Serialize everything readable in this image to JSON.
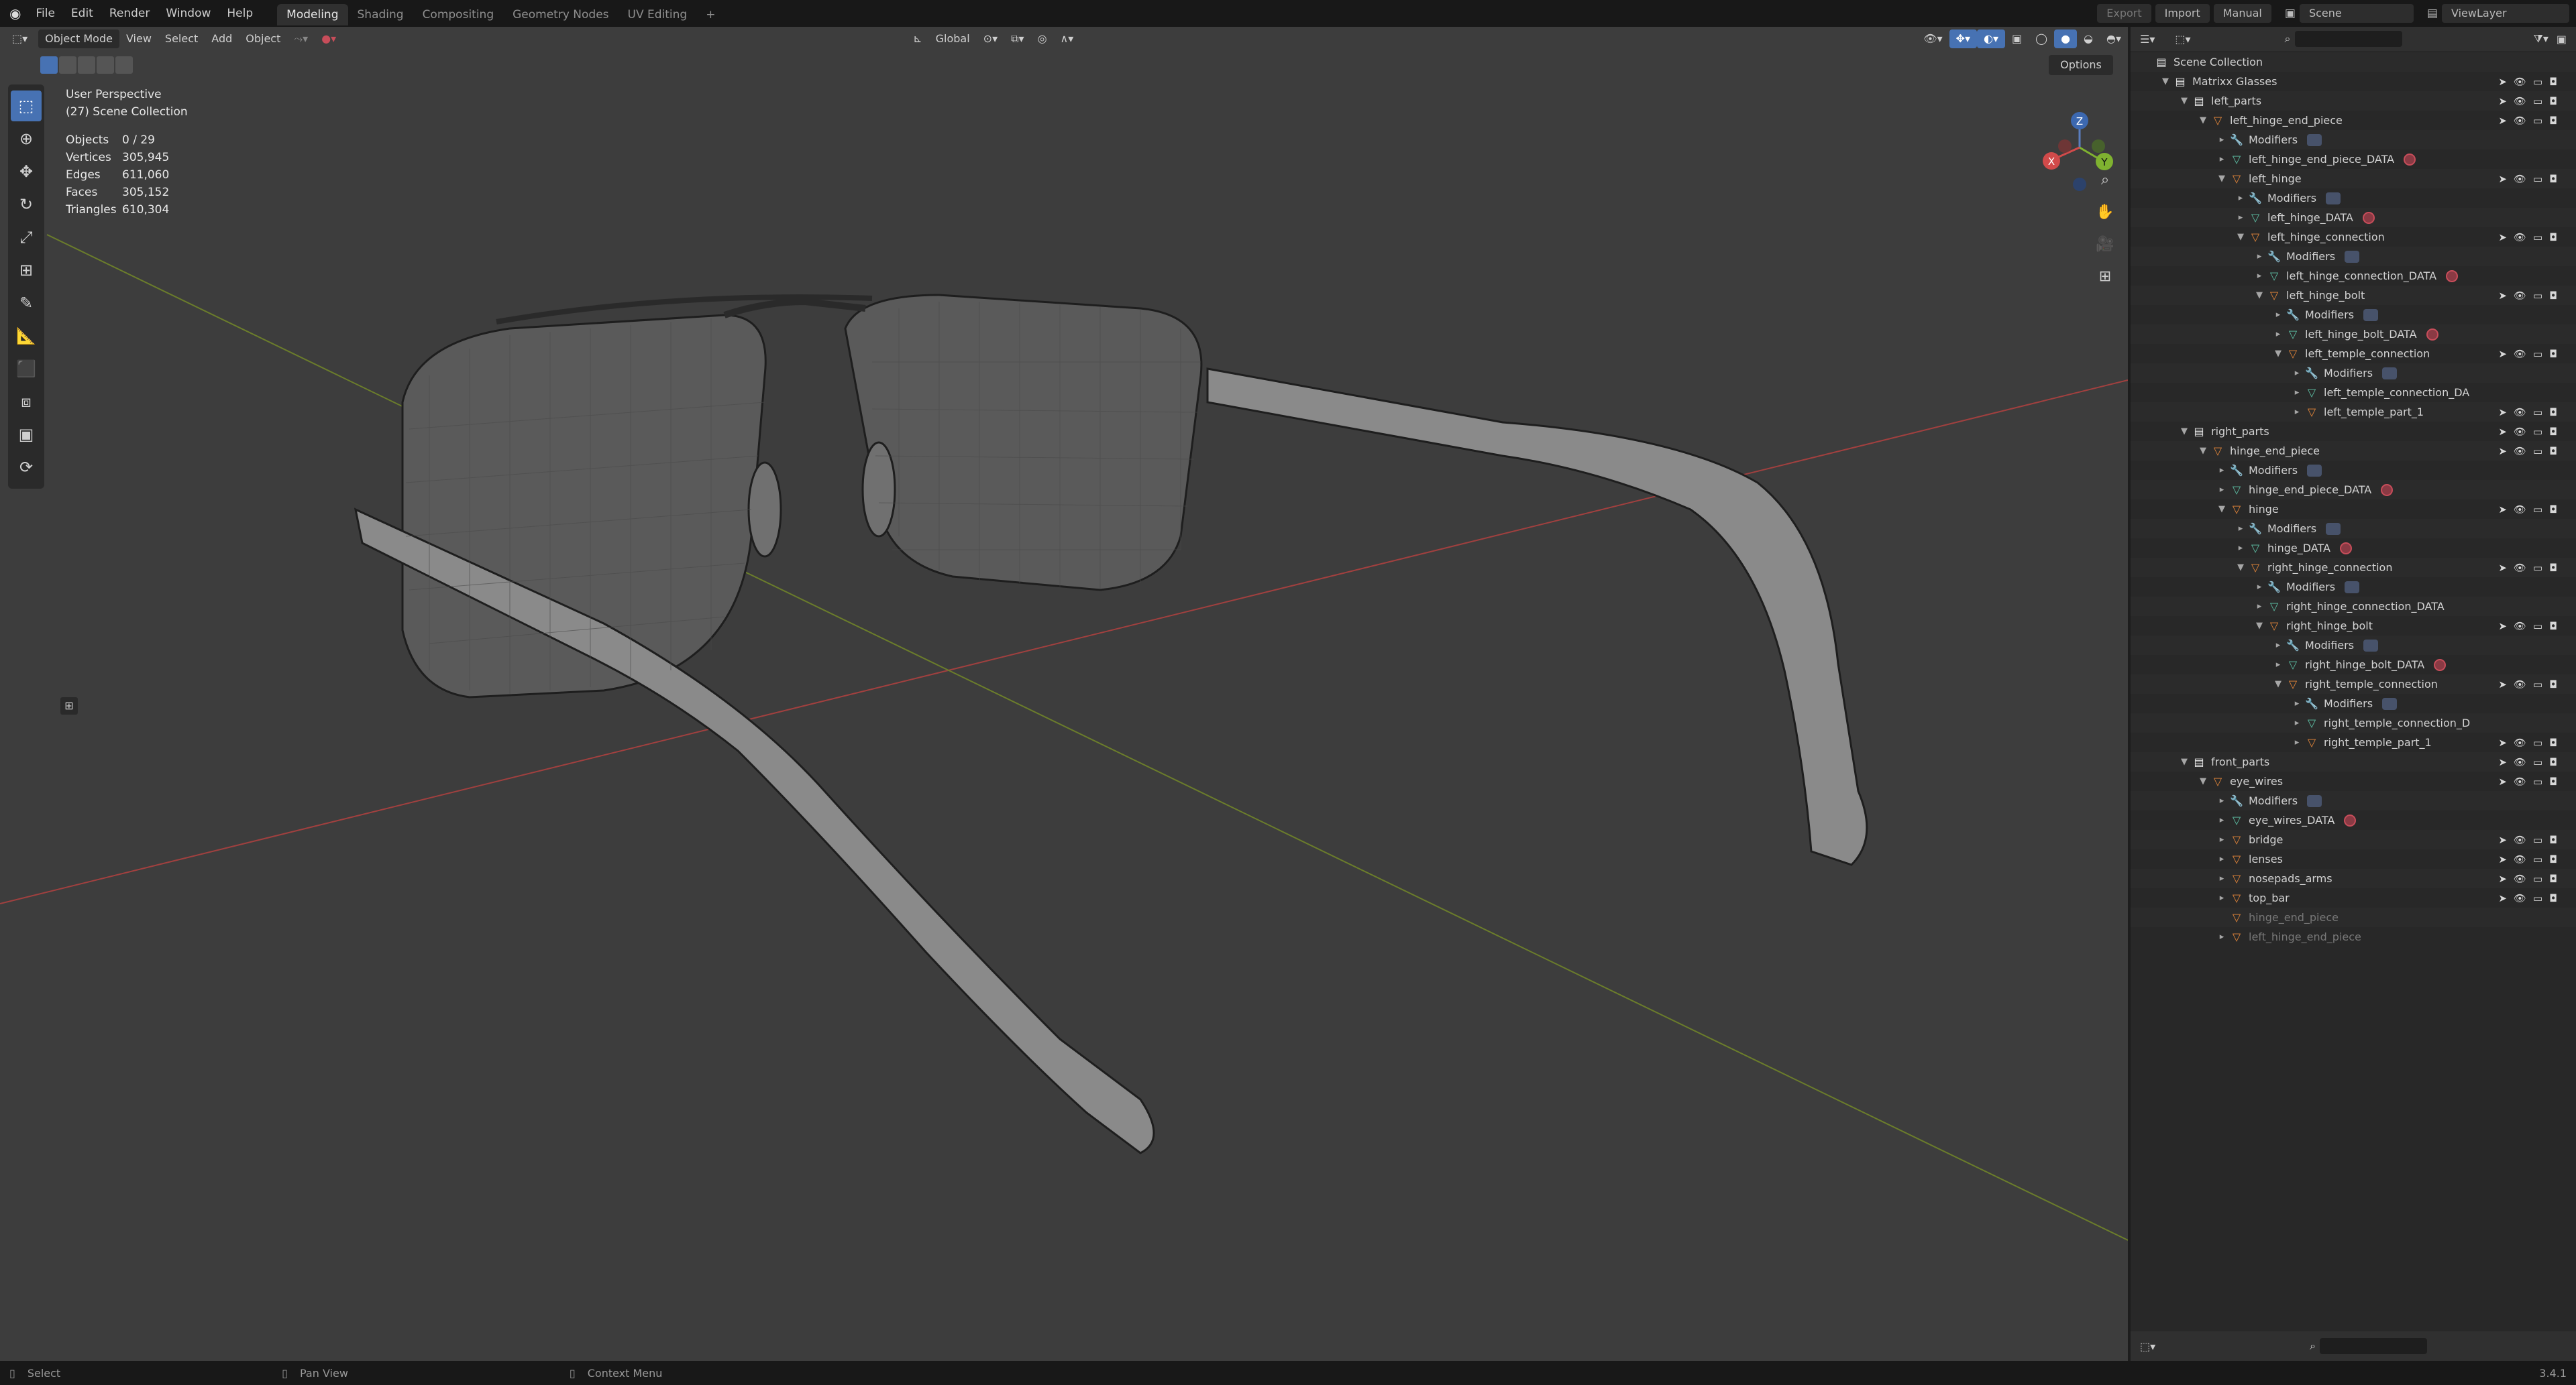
{
  "app": {
    "menus": [
      "File",
      "Edit",
      "Render",
      "Window",
      "Help"
    ],
    "workspace_tabs": [
      "Modeling",
      "Shading",
      "Compositing",
      "Geometry Nodes",
      "UV Editing"
    ],
    "active_workspace": "Modeling",
    "add_tab": "+",
    "top_buttons": {
      "export": "Export",
      "import": "Import",
      "manual": "Manual"
    },
    "scene_label": "Scene",
    "view_layer_label": "ViewLayer",
    "accent": "#4772b3"
  },
  "viewport": {
    "header": {
      "mode": "Object Mode",
      "menus": [
        "View",
        "Select",
        "Add",
        "Object"
      ],
      "transform_orientation": "Global",
      "options": "Options"
    },
    "overlay": {
      "view_name": "User Perspective",
      "collection": "(27) Scene Collection",
      "stats": [
        {
          "label": "Objects",
          "value": "0 / 29"
        },
        {
          "label": "Vertices",
          "value": "305,945"
        },
        {
          "label": "Edges",
          "value": "611,060"
        },
        {
          "label": "Faces",
          "value": "305,152"
        },
        {
          "label": "Triangles",
          "value": "610,304"
        }
      ]
    },
    "gizmo_axes": {
      "x": "X",
      "y": "Y",
      "z": "Z"
    },
    "tools": [
      "select-box-icon",
      "cursor-icon",
      "move-icon",
      "rotate-icon",
      "scale-icon",
      "transform-icon",
      "annotate-icon",
      "measure-icon",
      "add-cube-icon",
      "extrude-icon",
      "inset-icon",
      "spin-icon"
    ]
  },
  "outliner": {
    "search_placeholder": "",
    "rows": [
      {
        "depth": 0,
        "tri": "",
        "icon": "coll",
        "label": "Scene Collection",
        "badge": "",
        "vis": false,
        "dim": false
      },
      {
        "depth": 1,
        "tri": "▼",
        "icon": "coll",
        "label": "Matrixx Glasses",
        "badge": "",
        "vis": true,
        "dim": false
      },
      {
        "depth": 2,
        "tri": "▼",
        "icon": "coll",
        "label": "left_parts",
        "badge": "",
        "vis": true,
        "dim": false
      },
      {
        "depth": 3,
        "tri": "▼",
        "icon": "obj",
        "label": "left_hinge_end_piece",
        "badge": "",
        "vis": true,
        "dim": false
      },
      {
        "depth": 4,
        "tri": "▸",
        "icon": "mod",
        "label": "Modifiers",
        "badge": "mod",
        "vis": false,
        "dim": false
      },
      {
        "depth": 4,
        "tri": "▸",
        "icon": "mesh",
        "label": "left_hinge_end_piece_DATA",
        "badge": "data",
        "vis": false,
        "dim": false
      },
      {
        "depth": 4,
        "tri": "▼",
        "icon": "obj",
        "label": "left_hinge",
        "badge": "",
        "vis": true,
        "dim": false
      },
      {
        "depth": 5,
        "tri": "▸",
        "icon": "mod",
        "label": "Modifiers",
        "badge": "mod",
        "vis": false,
        "dim": false
      },
      {
        "depth": 5,
        "tri": "▸",
        "icon": "mesh",
        "label": "left_hinge_DATA",
        "badge": "data",
        "vis": false,
        "dim": false
      },
      {
        "depth": 5,
        "tri": "▼",
        "icon": "obj",
        "label": "left_hinge_connection",
        "badge": "",
        "vis": true,
        "dim": false
      },
      {
        "depth": 6,
        "tri": "▸",
        "icon": "mod",
        "label": "Modifiers",
        "badge": "mod",
        "vis": false,
        "dim": false
      },
      {
        "depth": 6,
        "tri": "▸",
        "icon": "mesh",
        "label": "left_hinge_connection_DATA",
        "badge": "data",
        "vis": false,
        "dim": false
      },
      {
        "depth": 6,
        "tri": "▼",
        "icon": "obj",
        "label": "left_hinge_bolt",
        "badge": "",
        "vis": true,
        "dim": false
      },
      {
        "depth": 7,
        "tri": "▸",
        "icon": "mod",
        "label": "Modifiers",
        "badge": "mod",
        "vis": false,
        "dim": false
      },
      {
        "depth": 7,
        "tri": "▸",
        "icon": "mesh",
        "label": "left_hinge_bolt_DATA",
        "badge": "data",
        "vis": false,
        "dim": false
      },
      {
        "depth": 7,
        "tri": "▼",
        "icon": "obj",
        "label": "left_temple_connection",
        "badge": "",
        "vis": true,
        "dim": false
      },
      {
        "depth": 8,
        "tri": "▸",
        "icon": "mod",
        "label": "Modifiers",
        "badge": "mod",
        "vis": false,
        "dim": false
      },
      {
        "depth": 8,
        "tri": "▸",
        "icon": "mesh",
        "label": "left_temple_connection_DA",
        "badge": "",
        "vis": false,
        "dim": false
      },
      {
        "depth": 8,
        "tri": "▸",
        "icon": "obj",
        "label": "left_temple_part_1",
        "badge": "",
        "vis": true,
        "dim": false
      },
      {
        "depth": 2,
        "tri": "▼",
        "icon": "coll",
        "label": "right_parts",
        "badge": "",
        "vis": true,
        "dim": false
      },
      {
        "depth": 3,
        "tri": "▼",
        "icon": "obj",
        "label": "hinge_end_piece",
        "badge": "",
        "vis": true,
        "dim": false
      },
      {
        "depth": 4,
        "tri": "▸",
        "icon": "mod",
        "label": "Modifiers",
        "badge": "mod",
        "vis": false,
        "dim": false
      },
      {
        "depth": 4,
        "tri": "▸",
        "icon": "mesh",
        "label": "hinge_end_piece_DATA",
        "badge": "data",
        "vis": false,
        "dim": false
      },
      {
        "depth": 4,
        "tri": "▼",
        "icon": "obj",
        "label": "hinge",
        "badge": "",
        "vis": true,
        "dim": false
      },
      {
        "depth": 5,
        "tri": "▸",
        "icon": "mod",
        "label": "Modifiers",
        "badge": "mod",
        "vis": false,
        "dim": false
      },
      {
        "depth": 5,
        "tri": "▸",
        "icon": "mesh",
        "label": "hinge_DATA",
        "badge": "data",
        "vis": false,
        "dim": false
      },
      {
        "depth": 5,
        "tri": "▼",
        "icon": "obj",
        "label": "right_hinge_connection",
        "badge": "",
        "vis": true,
        "dim": false
      },
      {
        "depth": 6,
        "tri": "▸",
        "icon": "mod",
        "label": "Modifiers",
        "badge": "mod",
        "vis": false,
        "dim": false
      },
      {
        "depth": 6,
        "tri": "▸",
        "icon": "mesh",
        "label": "right_hinge_connection_DATA",
        "badge": "",
        "vis": false,
        "dim": false
      },
      {
        "depth": 6,
        "tri": "▼",
        "icon": "obj",
        "label": "right_hinge_bolt",
        "badge": "",
        "vis": true,
        "dim": false
      },
      {
        "depth": 7,
        "tri": "▸",
        "icon": "mod",
        "label": "Modifiers",
        "badge": "mod",
        "vis": false,
        "dim": false
      },
      {
        "depth": 7,
        "tri": "▸",
        "icon": "mesh",
        "label": "right_hinge_bolt_DATA",
        "badge": "data",
        "vis": false,
        "dim": false
      },
      {
        "depth": 7,
        "tri": "▼",
        "icon": "obj",
        "label": "right_temple_connection",
        "badge": "",
        "vis": true,
        "dim": false
      },
      {
        "depth": 8,
        "tri": "▸",
        "icon": "mod",
        "label": "Modifiers",
        "badge": "mod",
        "vis": false,
        "dim": false
      },
      {
        "depth": 8,
        "tri": "▸",
        "icon": "mesh",
        "label": "right_temple_connection_D",
        "badge": "",
        "vis": false,
        "dim": false
      },
      {
        "depth": 8,
        "tri": "▸",
        "icon": "obj",
        "label": "right_temple_part_1",
        "badge": "",
        "vis": true,
        "dim": false
      },
      {
        "depth": 2,
        "tri": "▼",
        "icon": "coll",
        "label": "front_parts",
        "badge": "",
        "vis": true,
        "dim": false
      },
      {
        "depth": 3,
        "tri": "▼",
        "icon": "obj",
        "label": "eye_wires",
        "badge": "",
        "vis": true,
        "dim": false
      },
      {
        "depth": 4,
        "tri": "▸",
        "icon": "mod",
        "label": "Modifiers",
        "badge": "mod",
        "vis": false,
        "dim": false
      },
      {
        "depth": 4,
        "tri": "▸",
        "icon": "mesh",
        "label": "eye_wires_DATA",
        "badge": "data",
        "vis": false,
        "dim": false
      },
      {
        "depth": 4,
        "tri": "▸",
        "icon": "obj",
        "label": "bridge",
        "badge": "",
        "vis": true,
        "dim": false
      },
      {
        "depth": 4,
        "tri": "▸",
        "icon": "obj",
        "label": "lenses",
        "badge": "",
        "vis": true,
        "dim": false
      },
      {
        "depth": 4,
        "tri": "▸",
        "icon": "obj",
        "label": "nosepads_arms",
        "badge": "",
        "vis": true,
        "dim": false
      },
      {
        "depth": 4,
        "tri": "▸",
        "icon": "obj",
        "label": "top_bar",
        "badge": "",
        "vis": true,
        "dim": false
      },
      {
        "depth": 4,
        "tri": "",
        "icon": "obj",
        "label": "hinge_end_piece",
        "badge": "",
        "vis": false,
        "dim": true
      },
      {
        "depth": 4,
        "tri": "▸",
        "icon": "obj",
        "label": "left_hinge_end_piece",
        "badge": "",
        "vis": false,
        "dim": true
      }
    ]
  },
  "statusbar": {
    "items": [
      "Select",
      "Pan View",
      "Context Menu"
    ],
    "version": "3.4.1"
  }
}
